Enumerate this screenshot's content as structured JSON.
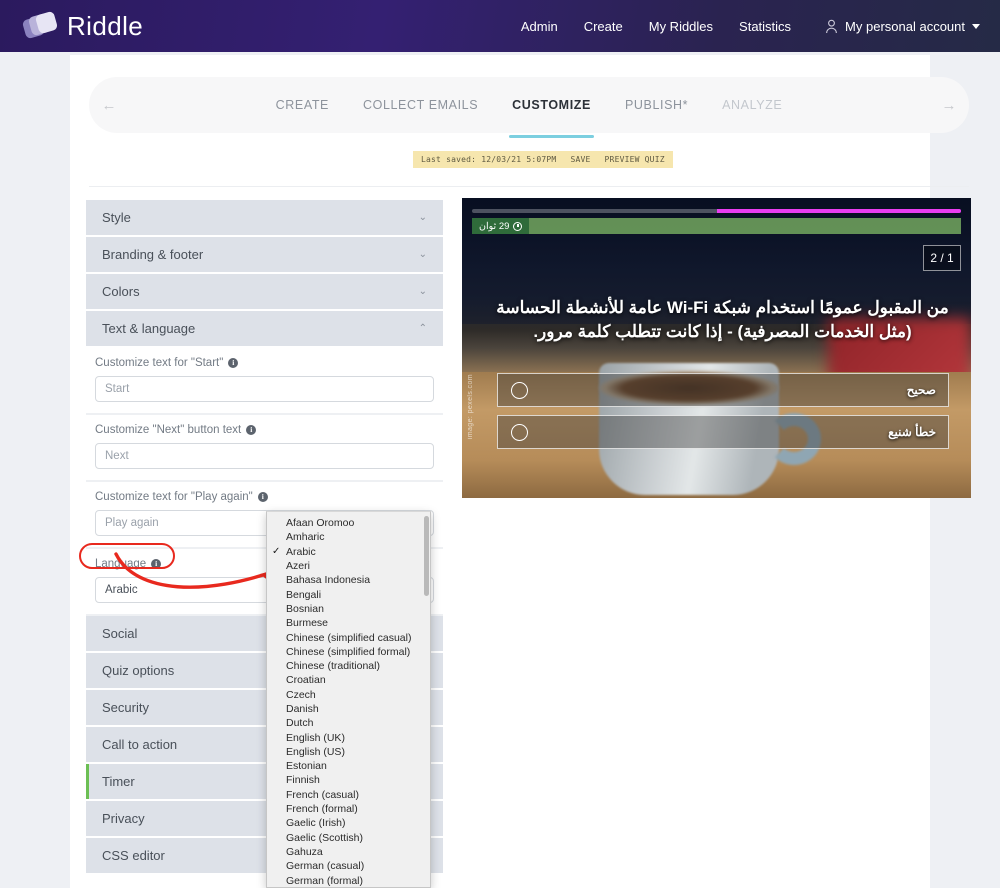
{
  "topbar": {
    "brand": "Riddle",
    "nav": [
      {
        "label": "Admin"
      },
      {
        "label": "Create"
      },
      {
        "label": "My Riddles"
      },
      {
        "label": "Statistics"
      }
    ],
    "account": {
      "label": "My personal account",
      "icon": "person-icon",
      "caret": "chevron-down-icon"
    }
  },
  "steps": {
    "prev_arrow": "←",
    "next_arrow": "→",
    "items": [
      {
        "label": "CREATE",
        "state": "done"
      },
      {
        "label": "COLLECT EMAILS",
        "state": "done"
      },
      {
        "label": "CUSTOMIZE",
        "state": "active"
      },
      {
        "label": "PUBLISH*",
        "state": "done"
      },
      {
        "label": "ANALYZE",
        "state": "muted"
      }
    ]
  },
  "saved_bar": {
    "last_saved": "Last saved: 12/03/21 5:07PM",
    "save": "SAVE",
    "preview": "PREVIEW QUIZ"
  },
  "accordion": {
    "sections": [
      {
        "label": "Style",
        "expanded": false
      },
      {
        "label": "Branding & footer",
        "expanded": false
      },
      {
        "label": "Colors",
        "expanded": false
      },
      {
        "label": "Text & language",
        "expanded": true
      },
      {
        "label": "Social",
        "expanded": false
      },
      {
        "label": "Quiz options",
        "expanded": false
      },
      {
        "label": "Security",
        "expanded": false
      },
      {
        "label": "Call to action",
        "expanded": false
      },
      {
        "label": "Timer",
        "expanded": false,
        "highlight": true
      },
      {
        "label": "Privacy",
        "expanded": false
      },
      {
        "label": "CSS editor",
        "expanded": false
      }
    ],
    "chevron_collapsed": "⌄",
    "chevron_expanded": "⌃",
    "fields": [
      {
        "label": "Customize text for \"Start\"",
        "value": "Start",
        "info": "info-icon"
      },
      {
        "label": "Customize \"Next\" button text",
        "value": "Next",
        "info": "info-icon"
      },
      {
        "label": "Customize text for \"Play again\"",
        "value": "Play again",
        "info": "info-icon"
      },
      {
        "label": "Language",
        "value": "Arabic",
        "info": "info-icon"
      }
    ]
  },
  "language_dropdown": {
    "selected": "Arabic",
    "check_glyph": "✓",
    "options": [
      "Afaan Oromoo",
      "Amharic",
      "Arabic",
      "Azeri",
      "Bahasa Indonesia",
      "Bengali",
      "Bosnian",
      "Burmese",
      "Chinese (simplified casual)",
      "Chinese (simplified formal)",
      "Chinese (traditional)",
      "Croatian",
      "Czech",
      "Danish",
      "Dutch",
      "English (UK)",
      "English (US)",
      "Estonian",
      "Finnish",
      "French (casual)",
      "French (formal)",
      "Gaelic (Irish)",
      "Gaelic (Scottish)",
      "Gahuza",
      "German (casual)",
      "German (formal)"
    ]
  },
  "preview": {
    "timer_badge": "29 ثوان",
    "counter": "1 / 2",
    "question": "من المقبول عمومًا استخدام شبكة Wi-Fi عامة للأنشطة الحساسة (مثل الخدمات المصرفية) - إذا كانت تتطلب كلمة مرور.",
    "answers": [
      {
        "label": "صحيح"
      },
      {
        "label": "خطأ شنيع"
      }
    ],
    "watermark": "image: pexels.com",
    "progress_percent": 50
  },
  "colors": {
    "brand_purple": "#2b1a5e",
    "accent_teal": "#7ccfe0",
    "accordion_header": "#dde1e8",
    "saved_bar": "#f6e6ae",
    "annotation_red": "#e8291e",
    "timer_green": "#6cbf54",
    "progress_magenta": "#e93df0"
  }
}
